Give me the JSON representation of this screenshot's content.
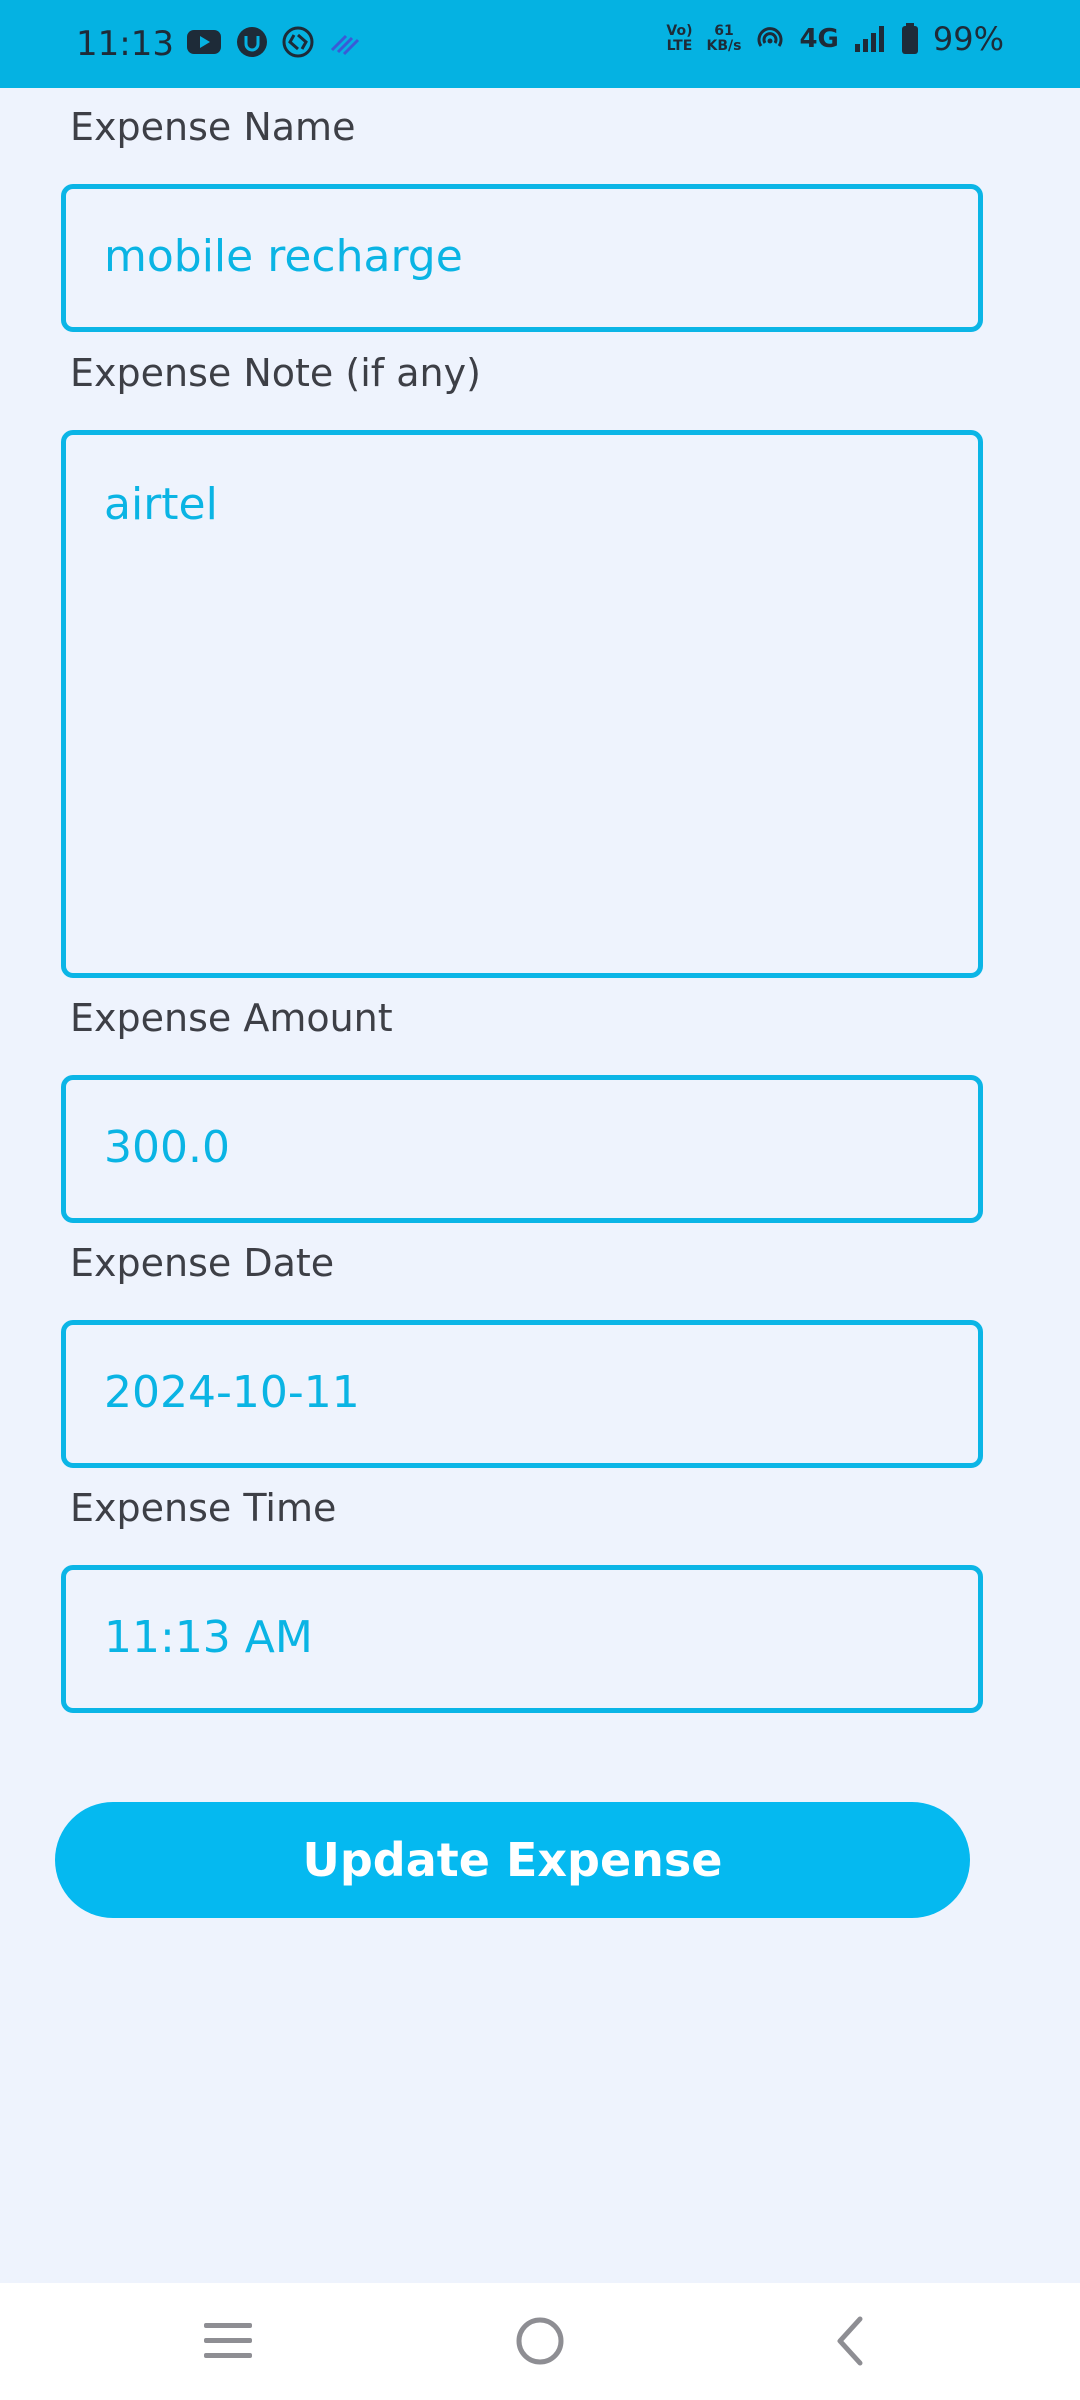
{
  "status_bar": {
    "time": "11:13",
    "left_icons": [
      "youtube-icon",
      "app-icon",
      "shazam-icon",
      "signal-wave-icon"
    ],
    "volte_top": "Vo)",
    "volte_bottom": "LTE",
    "speed_value": "61",
    "speed_unit": "KB/s",
    "network_type": "4G",
    "battery": "99%"
  },
  "form": {
    "name_label": "Expense Name",
    "name_value": "mobile recharge",
    "note_label": "Expense Note (if any)",
    "note_value": "airtel",
    "amount_label": "Expense Amount",
    "amount_value": "300.0",
    "date_label": "Expense Date",
    "date_value": "2024-10-11",
    "time_label": "Expense Time",
    "time_value": "11:13 AM"
  },
  "actions": {
    "update_label": "Update Expense"
  },
  "nav": {
    "icons": [
      "menu-icon",
      "home-icon",
      "back-icon"
    ]
  },
  "colors": {
    "accent": "#05b2e2",
    "button": "#05b9f0",
    "background": "#eef3fd"
  }
}
